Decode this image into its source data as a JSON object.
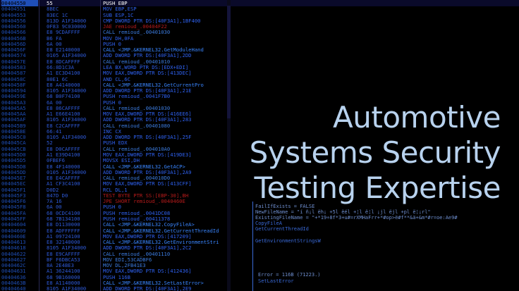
{
  "title": {
    "line1": "Automotive",
    "line2": "Systems Security",
    "line3": "Testing Expertise"
  },
  "disassembly": [
    {
      "addr": "00404550",
      "hex": "55",
      "asm": "PUSH EBP",
      "kind": "sel"
    },
    {
      "addr": "00404551",
      "hex": "8BEC",
      "asm": "MOV EBP,ESP",
      "kind": "n"
    },
    {
      "addr": "00404553",
      "hex": "83EC 1C",
      "asm": "SUB ESP,1C",
      "kind": "n"
    },
    {
      "addr": "00404556",
      "hex": "813D A1F34000",
      "asm": "CMP DWORD PTR DS:[40F3A1],1BF400",
      "kind": "n"
    },
    {
      "addr": "00404560",
      "hex": "0F83 9C030000",
      "asm": "JAE remioud_.00404F22",
      "kind": "jmp"
    },
    {
      "addr": "00404566",
      "hex": "E8 9CDAFFFF",
      "asm": "CALL remioud_.00401030",
      "kind": "call"
    },
    {
      "addr": "0040456B",
      "hex": "B6 FA",
      "asm": "MOV DH,0FA",
      "kind": "n"
    },
    {
      "addr": "0040456D",
      "hex": "6A 00",
      "asm": "PUSH 0",
      "kind": "n"
    },
    {
      "addr": "0040456F",
      "hex": "E8 E2140000",
      "asm": "CALL <JMP.&KERNEL32.GetModuleHand",
      "kind": "api"
    },
    {
      "addr": "00404574",
      "hex": "0105 A1F34000",
      "asm": "ADD DWORD PTR DS:[40F3A1],2DD",
      "kind": "n"
    },
    {
      "addr": "0040457E",
      "hex": "E8 8DCAFFFF",
      "asm": "CALL remioud_.00401010",
      "kind": "call"
    },
    {
      "addr": "00404583",
      "hex": "66:8D1C3A",
      "asm": "LEA BX,WORD PTR DS:[EDX+EDI]",
      "kind": "n"
    },
    {
      "addr": "00404587",
      "hex": "A1 EC3D4100",
      "asm": "MOV EAX,DWORD PTR DS:[413DEC]",
      "kind": "n"
    },
    {
      "addr": "0040458C",
      "hex": "80E1 6C",
      "asm": "AND CL,6C",
      "kind": "n"
    },
    {
      "addr": "0040458F",
      "hex": "E8 A4140000",
      "asm": "CALL <JMP.&KERNEL32.GetCurrentPro",
      "kind": "api"
    },
    {
      "addr": "00404594",
      "hex": "8105 A1F34000",
      "asm": "ADD DWORD PTR DS:[40F3A1],21E",
      "kind": "n"
    },
    {
      "addr": "0040459E",
      "hex": "68 B0F74100",
      "asm": "PUSH remioud_.0041F7B0",
      "kind": "n"
    },
    {
      "addr": "004045A3",
      "hex": "6A 00",
      "asm": "PUSH 0",
      "kind": "n"
    },
    {
      "addr": "004045A5",
      "hex": "E8 86CAFFFF",
      "asm": "CALL remioud_.00401030",
      "kind": "call"
    },
    {
      "addr": "004045AA",
      "hex": "A1 E66E4100",
      "asm": "MOV EAX,DWORD PTR DS:[416EE6]",
      "kind": "n"
    },
    {
      "addr": "004045AF",
      "hex": "8105 A1F34000",
      "asm": "ADD DWORD PTR DS:[40F3A1],283",
      "kind": "n"
    },
    {
      "addr": "004045B9",
      "hex": "E8 C2CAFFFF",
      "asm": "CALL remioud_.00401080",
      "kind": "call"
    },
    {
      "addr": "004045BE",
      "hex": "66:41",
      "asm": "INC CX",
      "kind": "n"
    },
    {
      "addr": "004045C0",
      "hex": "8105 A1F34000",
      "asm": "ADD DWORD PTR DS:[40F3A1],25F",
      "kind": "n"
    },
    {
      "addr": "004045CA",
      "hex": "52",
      "asm": "PUSH EDX",
      "kind": "n"
    },
    {
      "addr": "004045CB",
      "hex": "E8 D0CAFFFF",
      "asm": "CALL remioud_.004010A0",
      "kind": "call"
    },
    {
      "addr": "004045D0",
      "hex": "A1 E39D4100",
      "asm": "MOV EAX,DWORD PTR DS:[419DE3]",
      "kind": "n"
    },
    {
      "addr": "004045D5",
      "hex": "0FBEF6",
      "asm": "MOVSX ESI,DH",
      "kind": "n"
    },
    {
      "addr": "004045D8",
      "hex": "E8 4F140000",
      "asm": "CALL <JMP.&KERNEL32.GetACP>",
      "kind": "api"
    },
    {
      "addr": "004045DD",
      "hex": "0105 A1F34000",
      "asm": "ADD DWORD PTR DS:[40F3A1],2A9",
      "kind": "n"
    },
    {
      "addr": "004045E7",
      "hex": "E8 E4CAFFFF",
      "asm": "CALL remioud_.004010D0",
      "kind": "call"
    },
    {
      "addr": "004045EC",
      "hex": "A1 CF3C4100",
      "asm": "MOV EAX,DWORD PTR DS:[413CFF]",
      "kind": "n"
    },
    {
      "addr": "004045F1",
      "hex": "D0D2",
      "asm": "RCL DL,1",
      "kind": "n"
    },
    {
      "addr": "004045F3",
      "hex": "847D D0",
      "asm": "TEST BYTE PTR SS:[EBP-30],BH",
      "kind": "jmp"
    },
    {
      "addr": "004045F6",
      "hex": "7A 16",
      "asm": "JPE SHORT remioud_.0040460E",
      "kind": "jmp"
    },
    {
      "addr": "004045F8",
      "hex": "6A 00",
      "asm": "PUSH 0",
      "kind": "n"
    },
    {
      "addr": "004045FA",
      "hex": "68 0CDC4100",
      "asm": "PUSH remioud_.0041DC08",
      "kind": "n"
    },
    {
      "addr": "004045FF",
      "hex": "68 7B134100",
      "asm": "PUSH remioud_.00411378",
      "kind": "n"
    },
    {
      "addr": "00404604",
      "hex": "E8 D1130000",
      "asm": "CALL <JMP.&KERNEL32.CopyFileA>",
      "kind": "api"
    },
    {
      "addr": "00404609",
      "hex": "E8 ADFFFFFF",
      "asm": "CALL <JMP.&KERNEL32.GetCurrentThreadId",
      "kind": "api"
    },
    {
      "addr": "0040460E",
      "hex": "A1 09724100",
      "asm": "MOV EAX,DWORD PTR DS:[417209]",
      "kind": "n"
    },
    {
      "addr": "00404613",
      "hex": "E8 32140000",
      "asm": "CALL <JMP.&KERNEL32.GetEnvironmentStri",
      "kind": "api"
    },
    {
      "addr": "00404618",
      "hex": "8105 A1F34000",
      "asm": "ADD DWORD PTR DS:[40F3A1],2C2",
      "kind": "n"
    },
    {
      "addr": "00404622",
      "hex": "E8 E9CAFFFF",
      "asm": "CALL remioud_.00401110",
      "kind": "call"
    },
    {
      "addr": "00404627",
      "hex": "BF F6DBCA53",
      "asm": "MOV EDI,53CADBF6",
      "kind": "call"
    },
    {
      "addr": "0040462C",
      "hex": "8A 2E4BE3",
      "asm": "MOV DL,2FB41E3",
      "kind": "call"
    },
    {
      "addr": "00404631",
      "hex": "A1 36244100",
      "asm": "MOV EAX,DWORD PTR DS:[412436]",
      "kind": "n"
    },
    {
      "addr": "00404636",
      "hex": "68 9B160000",
      "asm": "PUSH 116B",
      "kind": "n"
    },
    {
      "addr": "0040463B",
      "hex": "E8 A1140000",
      "asm": "CALL <JMP.&KERNEL32.SetLastError>",
      "kind": "api"
    },
    {
      "addr": "00404640",
      "hex": "8105 A1F34000",
      "asm": "ADD DWORD PTR DS:[40F3A1],2E9",
      "kind": "n"
    }
  ],
  "comments": {
    "c1": "FailIfExists = FALSE",
    "c2": "NewFileName = \"í ñ¡l ëh¡ +5l ëél +¦l ë¦l ¡jl ëjl +pl ë¦¡rl\"",
    "c3": "ExistingFileName = \"+*19÷8f*3+u#=rXMHaFrr+*#op>ë#f**&ä+&m*#r=oe:Ae9#",
    "c4": "CopyFileA",
    "c5": "GetCurrentThreadId",
    "c6": "GetEnvironmentStringsW",
    "c7": "Error = 116B (71223.)",
    "c8": "SetLastError"
  }
}
